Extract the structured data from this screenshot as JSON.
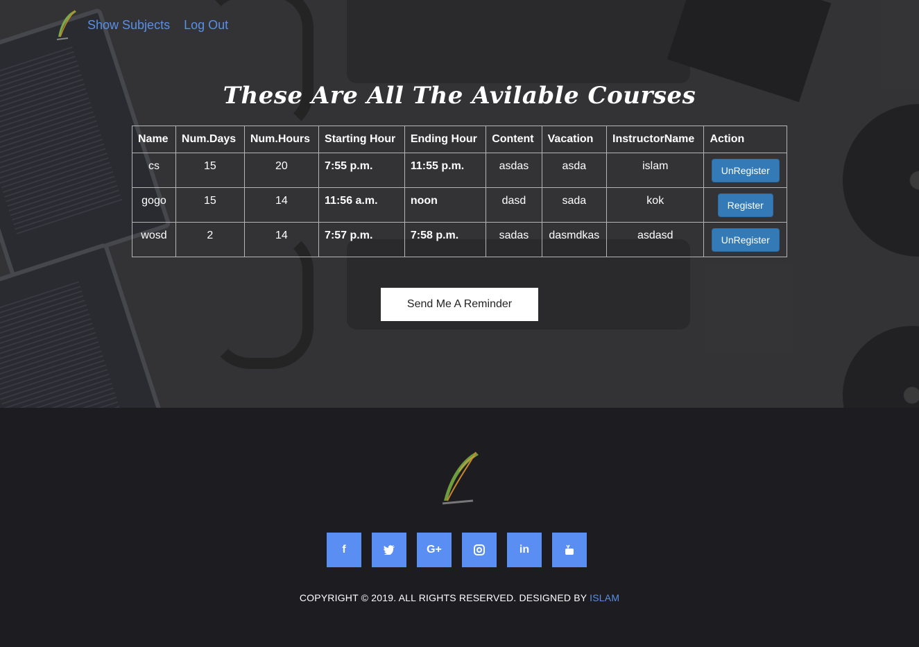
{
  "nav": {
    "logo": "feather-logo",
    "links": [
      "Show Subjects",
      "Log Out"
    ]
  },
  "page_title": "These Are All The Avilable Courses",
  "table": {
    "headers": [
      "Name",
      "Num.Days",
      "Num.Hours",
      "Starting Hour",
      "Ending Hour",
      "Content",
      "Vacation",
      "InstructorName",
      "Action"
    ],
    "rows": [
      {
        "name": "cs",
        "days": "15",
        "hours": "20",
        "start": "7:55 p.m.",
        "end": "11:55 p.m.",
        "content": "asdas",
        "vacation": "asda",
        "instructor": "islam",
        "action": "UnRegister"
      },
      {
        "name": "gogo",
        "days": "15",
        "hours": "14",
        "start": "11:56 a.m.",
        "end": "noon",
        "content": "dasd",
        "vacation": "sada",
        "instructor": "kok",
        "action": "Register"
      },
      {
        "name": "wosd",
        "days": "2",
        "hours": "14",
        "start": "7:57 p.m.",
        "end": "7:58 p.m.",
        "content": "sadas",
        "vacation": "dasmdkas",
        "instructor": "asdasd",
        "action": "UnRegister"
      }
    ]
  },
  "reminder_button": "Send Me A Reminder",
  "footer": {
    "logo": "feather-logo",
    "socials": [
      {
        "icon": "facebook-icon",
        "glyph": "f"
      },
      {
        "icon": "twitter-icon",
        "glyph": "t"
      },
      {
        "icon": "google-plus-icon",
        "glyph": "G+"
      },
      {
        "icon": "instagram-icon",
        "glyph": "◎"
      },
      {
        "icon": "linkedin-icon",
        "glyph": "in"
      },
      {
        "icon": "youtube-icon",
        "glyph": "▶"
      }
    ],
    "copyright_text": "COPYRIGHT © 2019. ALL RIGHTS RESERVED. DESIGNED BY",
    "copyright_link": "ISLAM"
  },
  "colors": {
    "link": "#5b8fe6",
    "button": "#337ab7",
    "social": "#5b8ef2",
    "footer_bg": "#1c1c21"
  }
}
